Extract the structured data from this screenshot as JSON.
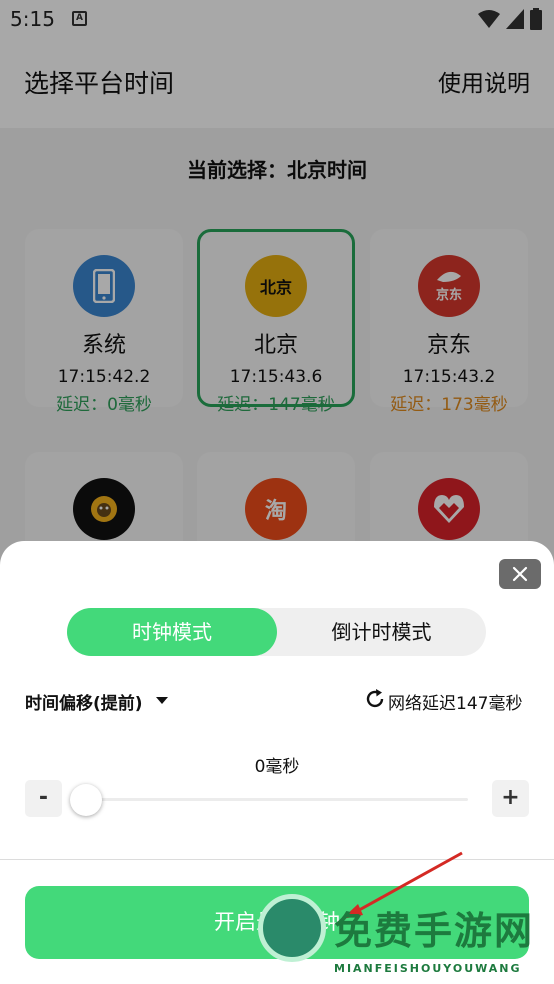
{
  "status": {
    "time": "5:15",
    "notification_icon": "A"
  },
  "header": {
    "title": "选择平台时间",
    "help": "使用说明"
  },
  "current_selection": "当前选择：北京时间",
  "platforms": [
    {
      "name": "系统",
      "time": "17:15:42.2",
      "delay": "延迟：0毫秒",
      "icon": "phone-icon",
      "color": "#3a86d1",
      "delay_color": "#2ea05a"
    },
    {
      "name": "北京",
      "time": "17:15:43.6",
      "delay": "延迟：147毫秒",
      "icon": "beijing-logo",
      "logo_text": "北京",
      "color": "#e4ae12",
      "delay_color": "#2ea05a"
    },
    {
      "name": "京东",
      "time": "17:15:43.2",
      "delay": "延迟：173毫秒",
      "icon": "jd-logo",
      "logo_text": "京东",
      "color": "#d6382c",
      "delay_color": "#e08a1e"
    }
  ],
  "row2_logos": [
    {
      "icon": "suning-logo",
      "color": "#111111"
    },
    {
      "icon": "taobao-logo",
      "logo_text": "淘",
      "color": "#ee4d1a"
    },
    {
      "icon": "pinduoduo-logo",
      "color": "#d9222a"
    }
  ],
  "sheet": {
    "mode_clock": "时钟模式",
    "mode_countdown": "倒计时模式",
    "offset_label": "时间偏移(提前)",
    "net_delay": "网络延迟147毫秒",
    "slider_value": "0毫秒",
    "slider_fraction": 0,
    "minus": "-",
    "plus": "+",
    "start_button": "开启悬浮时钟"
  },
  "watermark": {
    "text": "免费手游网",
    "sub": "MIANFEISHOUYOUWANG"
  },
  "colors": {
    "accent": "#43d97a",
    "selected_border": "#28a45a"
  }
}
